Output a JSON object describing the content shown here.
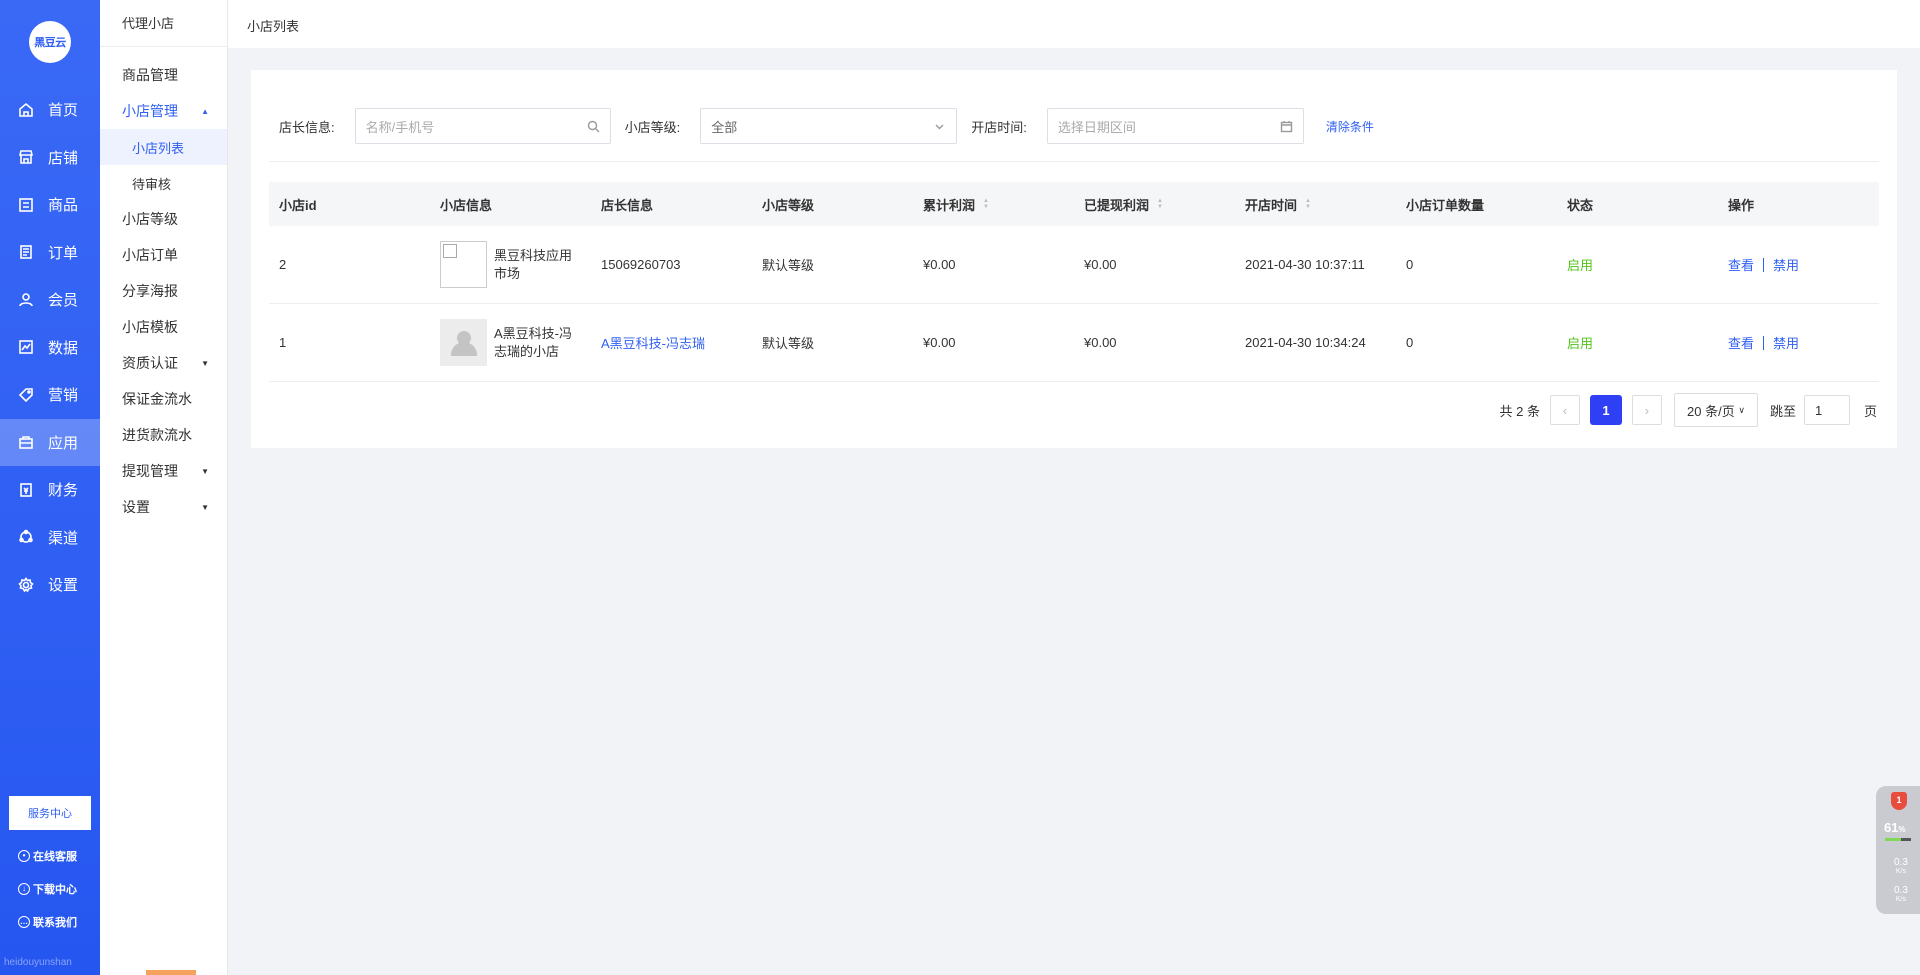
{
  "brand": {
    "logo_text": "黑豆云",
    "footer_text": "heidouyunshan"
  },
  "rail": {
    "items": [
      {
        "label": "首页",
        "icon": "home-icon",
        "active": false
      },
      {
        "label": "店铺",
        "icon": "store-icon",
        "active": false
      },
      {
        "label": "商品",
        "icon": "goods-icon",
        "active": false
      },
      {
        "label": "订单",
        "icon": "order-icon",
        "active": false
      },
      {
        "label": "会员",
        "icon": "member-icon",
        "active": false
      },
      {
        "label": "数据",
        "icon": "chart-icon",
        "active": false
      },
      {
        "label": "营销",
        "icon": "tag-icon",
        "active": false
      },
      {
        "label": "应用",
        "icon": "app-icon",
        "active": true
      },
      {
        "label": "财务",
        "icon": "finance-icon",
        "active": false
      },
      {
        "label": "渠道",
        "icon": "channel-icon",
        "active": false
      },
      {
        "label": "设置",
        "icon": "gear-icon",
        "active": false
      }
    ],
    "service_label": "服务中心",
    "links": {
      "online": "在线客服",
      "download": "下载中心",
      "contact": "联系我们"
    }
  },
  "side": {
    "title": "代理小店",
    "items": {
      "goods": "商品管理",
      "shop_manage": "小店管理",
      "shop_list": "小店列表",
      "pending": "待审核",
      "level": "小店等级",
      "orders": "小店订单",
      "poster": "分享海报",
      "template": "小店模板",
      "qualification": "资质认证",
      "deposit": "保证金流水",
      "purchase": "进货款流水",
      "withdraw": "提现管理",
      "settings": "设置"
    }
  },
  "breadcrumb": "小店列表",
  "filter": {
    "owner_label": "店长信息:",
    "owner_placeholder": "名称/手机号",
    "level_label": "小店等级:",
    "level_value": "全部",
    "time_label": "开店时间:",
    "time_placeholder": "选择日期区间",
    "clear": "清除条件"
  },
  "table": {
    "headers": [
      "小店id",
      "小店信息",
      "店长信息",
      "小店等级",
      "累计利润",
      "已提现利润",
      "开店时间",
      "小店订单数量",
      "状态",
      "操作"
    ],
    "rows": [
      {
        "id": "2",
        "shop": "黑豆科技应用市场",
        "owner": "15069260703",
        "owner_is_link": false,
        "level": "默认等级",
        "profit": "¥0.00",
        "withdrawn": "¥0.00",
        "opened": "2021-04-30 10:37:11",
        "orders": "0",
        "status": "启用",
        "view": "查看",
        "disable": "禁用"
      },
      {
        "id": "1",
        "shop": "A黑豆科技-冯志瑞的小店",
        "owner": "A黑豆科技-冯志瑞",
        "owner_is_link": true,
        "level": "默认等级",
        "profit": "¥0.00",
        "withdrawn": "¥0.00",
        "opened": "2021-04-30 10:34:24",
        "orders": "0",
        "status": "启用",
        "view": "查看",
        "disable": "禁用"
      }
    ]
  },
  "pager": {
    "total": "共 2 条",
    "current": "1",
    "size": "20 条/页",
    "jump_label": "跳至",
    "jump_value": "1",
    "page_suffix": "页"
  },
  "widget": {
    "badge": "1",
    "percent": "61",
    "percent_unit": "%",
    "up": "0.3",
    "down": "0.3",
    "unit": "K/s",
    "load": 0.6
  },
  "colors": {
    "primary": "#2f5ff3",
    "success": "#52c41a"
  }
}
